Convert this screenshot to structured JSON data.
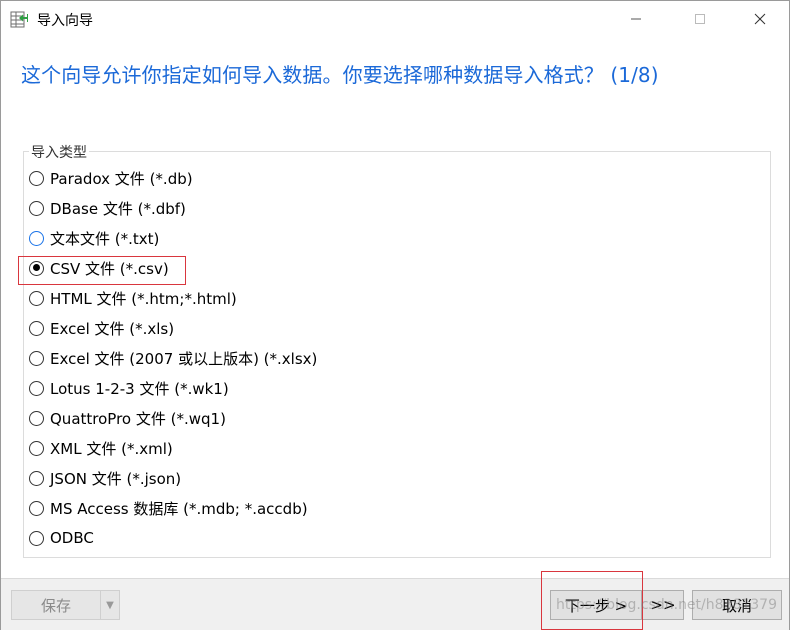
{
  "window": {
    "title": "导入向导",
    "minimize_glyph": "—",
    "maximize_glyph": "☐",
    "close_glyph": "✕"
  },
  "heading": "这个向导允许你指定如何导入数据。你要选择哪种数据导入格式？ (1/8)",
  "import_type": {
    "legend": "导入类型",
    "options": [
      {
        "label": "Paradox 文件 (*.db)",
        "checked": false
      },
      {
        "label": "DBase 文件 (*.dbf)",
        "checked": false
      },
      {
        "label": "文本文件 (*.txt)",
        "checked": false
      },
      {
        "label": "CSV 文件 (*.csv)",
        "checked": true
      },
      {
        "label": "HTML 文件 (*.htm;*.html)",
        "checked": false
      },
      {
        "label": "Excel 文件 (*.xls)",
        "checked": false
      },
      {
        "label": "Excel 文件 (2007 或以上版本) (*.xlsx)",
        "checked": false
      },
      {
        "label": "Lotus 1-2-3 文件 (*.wk1)",
        "checked": false
      },
      {
        "label": "QuattroPro 文件 (*.wq1)",
        "checked": false
      },
      {
        "label": "XML 文件 (*.xml)",
        "checked": false
      },
      {
        "label": "JSON 文件 (*.json)",
        "checked": false
      },
      {
        "label": "MS Access 数据库 (*.mdb; *.accdb)",
        "checked": false
      },
      {
        "label": "ODBC",
        "checked": false
      }
    ]
  },
  "footer": {
    "save_label": "保存",
    "next_label": "下一步 >",
    "last_label": ">>",
    "cancel_label": "取消"
  },
  "watermark": "https://blog.csdn.net/h8381379",
  "colors": {
    "heading": "#1b69d8",
    "highlight": "#d9363e"
  }
}
